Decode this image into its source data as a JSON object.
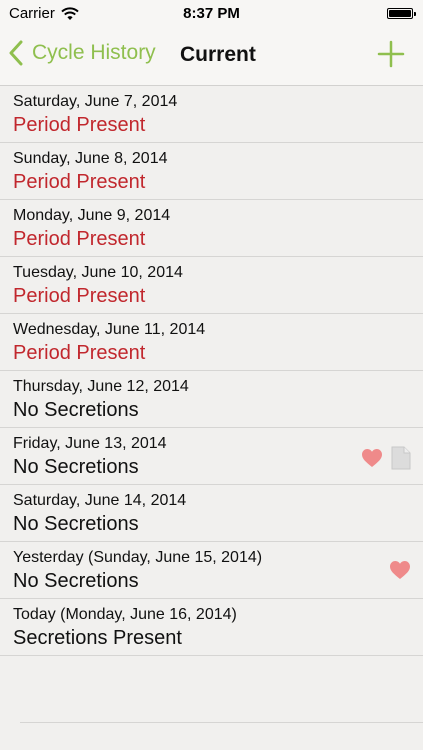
{
  "status_bar": {
    "carrier": "Carrier",
    "time": "8:37 PM"
  },
  "nav": {
    "back_label": "Cycle History",
    "title": "Current",
    "accent_color": "#8fbf4e"
  },
  "entries": [
    {
      "date": "Saturday, June 7, 2014",
      "status": "Period Present",
      "status_color": "#c1272d",
      "heart": false,
      "note": false
    },
    {
      "date": "Sunday, June 8, 2014",
      "status": "Period Present",
      "status_color": "#c1272d",
      "heart": false,
      "note": false
    },
    {
      "date": "Monday, June 9, 2014",
      "status": "Period Present",
      "status_color": "#c1272d",
      "heart": false,
      "note": false
    },
    {
      "date": "Tuesday, June 10, 2014",
      "status": "Period Present",
      "status_color": "#c1272d",
      "heart": false,
      "note": false
    },
    {
      "date": "Wednesday, June 11, 2014",
      "status": "Period Present",
      "status_color": "#c1272d",
      "heart": false,
      "note": false
    },
    {
      "date": "Thursday, June 12, 2014",
      "status": "No Secretions",
      "status_color": "#111111",
      "heart": false,
      "note": false
    },
    {
      "date": "Friday, June 13, 2014",
      "status": "No Secretions",
      "status_color": "#111111",
      "heart": true,
      "note": true
    },
    {
      "date": "Saturday, June 14, 2014",
      "status": "No Secretions",
      "status_color": "#111111",
      "heart": false,
      "note": false
    },
    {
      "date": "Yesterday (Sunday, June 15, 2014)",
      "status": "No Secretions",
      "status_color": "#111111",
      "heart": true,
      "note": false
    },
    {
      "date": "Today (Monday, June 16, 2014)",
      "status": "Secretions Present",
      "status_color": "#111111",
      "heart": false,
      "note": false
    }
  ],
  "icons": {
    "wifi": "wifi-icon",
    "battery": "battery-icon",
    "back": "chevron-left-icon",
    "add": "plus-icon",
    "intercourse": "heart-icon",
    "note": "note-icon"
  },
  "colors": {
    "heart": "#ef8a8a",
    "note": "#d6d6d6"
  }
}
